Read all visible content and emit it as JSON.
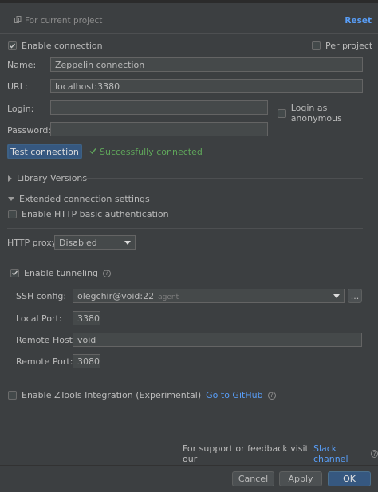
{
  "header": {
    "scope_label": "For current project",
    "reset_label": "Reset"
  },
  "connection": {
    "enable_label": "Enable connection",
    "per_project_label": "Per project",
    "name_label": "Name:",
    "name_value": "Zeppelin connection",
    "url_label": "URL:",
    "url_value": "localhost:3380",
    "login_label": "Login:",
    "login_value": "",
    "anonymous_label": "Login as anonymous",
    "password_label": "Password:",
    "password_value": "",
    "test_button": "Test connection",
    "status": "Successfully connected"
  },
  "sections": {
    "library_versions": "Library Versions",
    "extended_settings": "Extended connection settings"
  },
  "extended": {
    "http_auth_label": "Enable HTTP basic authentication",
    "proxy_label": "HTTP proxy",
    "proxy_value": "Disabled",
    "tunneling_label": "Enable tunneling",
    "ssh_config_label": "SSH config:",
    "ssh_config_value": "olegchir@void:22",
    "ssh_config_tag": "agent",
    "ssh_more_button": "...",
    "local_port_label": "Local Port:",
    "local_port_value": "3380",
    "remote_host_label": "Remote Host:",
    "remote_host_value": "void",
    "remote_port_label": "Remote Port:",
    "remote_port_value": "3080"
  },
  "ztools": {
    "label": "Enable ZTools Integration (Experimental)",
    "github_link": "Go to GitHub"
  },
  "footer": {
    "support_text": "For support or feedback visit our",
    "slack_link": "Slack channel"
  },
  "buttons": {
    "cancel": "Cancel",
    "apply": "Apply",
    "ok": "OK"
  }
}
